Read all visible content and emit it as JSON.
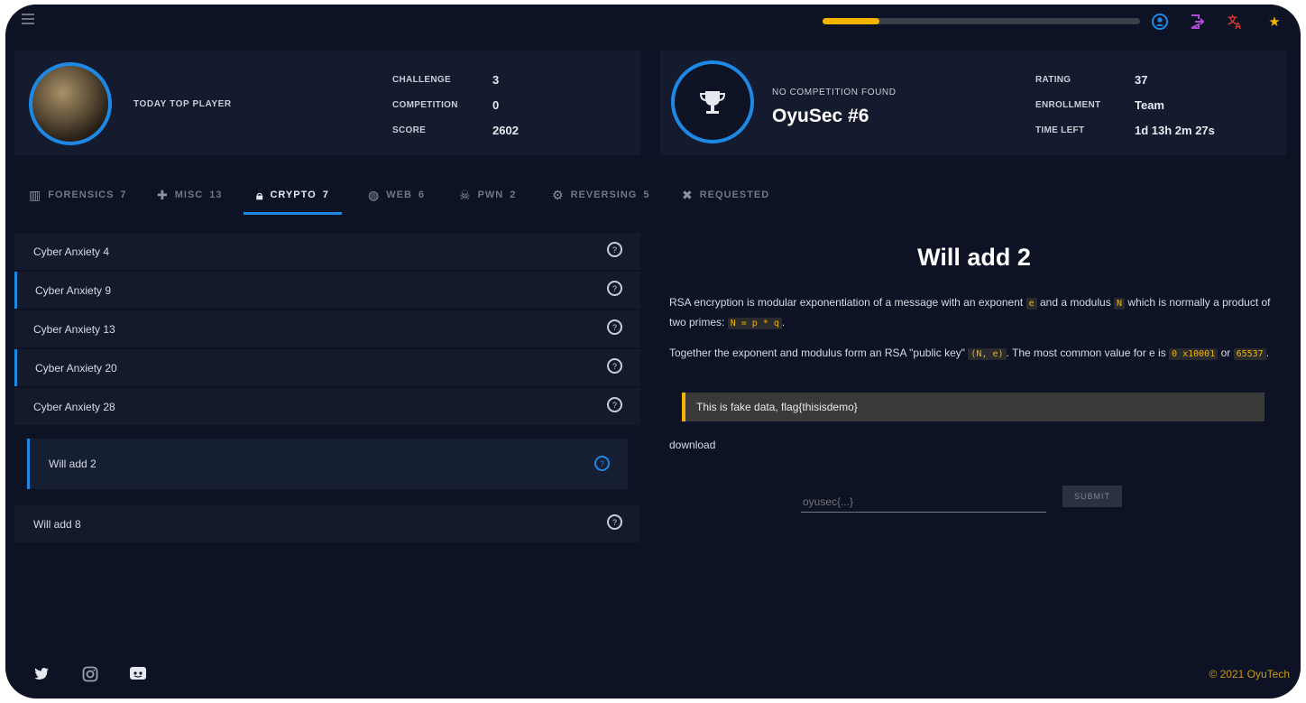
{
  "colors": {
    "background": "#0d1324",
    "card": "#141b2e",
    "accent": "#1e88e5",
    "highlight": "#f4b400"
  },
  "header": {
    "progress": 0.18,
    "icons": [
      "user-icon",
      "logout-icon",
      "translate-icon",
      "star-icon"
    ]
  },
  "top_player": {
    "label": "TODAY TOP PLAYER",
    "stats": [
      {
        "label": "CHALLENGE",
        "value": "3"
      },
      {
        "label": "COMPETITION",
        "value": "0"
      },
      {
        "label": "SCORE",
        "value": "2602"
      }
    ]
  },
  "competition": {
    "status": "NO COMPETITION FOUND",
    "name": "OyuSec #6",
    "stats": [
      {
        "label": "RATING",
        "value": "37"
      },
      {
        "label": "ENROLLMENT",
        "value": "Team"
      },
      {
        "label": "TIME LEFT",
        "value": "1d 13h 2m 27s"
      }
    ]
  },
  "tabs": [
    {
      "label": "FORENSICS",
      "count": "7",
      "icon": "building-icon"
    },
    {
      "label": "MISC",
      "count": "13",
      "icon": "puzzle-icon"
    },
    {
      "label": "CRYPTO",
      "count": "7",
      "icon": "lock-icon",
      "active": true
    },
    {
      "label": "WEB",
      "count": "6",
      "icon": "globe-icon"
    },
    {
      "label": "PWN",
      "count": "2",
      "icon": "skull-icon"
    },
    {
      "label": "REVERSING",
      "count": "5",
      "icon": "gear-icon"
    },
    {
      "label": "REQUESTED",
      "count": "",
      "icon": "request-icon"
    }
  ],
  "challenges": [
    {
      "name": "Cyber Anxiety 4"
    },
    {
      "name": "Cyber Anxiety 9"
    },
    {
      "name": "Cyber Anxiety 13"
    },
    {
      "name": "Cyber Anxiety 20"
    },
    {
      "name": "Cyber Anxiety 28"
    },
    {
      "name": "Will add 2"
    },
    {
      "name": "Will add 8"
    }
  ],
  "detail": {
    "title": "Will add 2",
    "p1_a": "RSA encryption is modular exponentiation of a message with an exponent",
    "p1_code_e": "e",
    "p1_b": "and a modulus",
    "p1_code_n": "N",
    "p1_c": "which is normally a product of two primes:",
    "p1_code_eq": "N = p * q",
    "p1_end": ".",
    "p2_a": "Together the exponent and modulus form an RSA \"public key\"",
    "p2_code_key": "(N, e)",
    "p2_b": ". The most common value for e is",
    "p2_code_hex": "0 x10001",
    "p2_c": "or",
    "p2_code_dec": "65537",
    "p2_end": ".",
    "flag_text": "This is fake data, flag{thisisdemo}",
    "download_label": "download",
    "input_placeholder": "oyusec{...}",
    "submit_label": "SUBMIT"
  },
  "footer": {
    "social": [
      "twitter-icon",
      "instagram-icon",
      "discord-icon"
    ],
    "copyright": "© 2021 OyuTech"
  }
}
